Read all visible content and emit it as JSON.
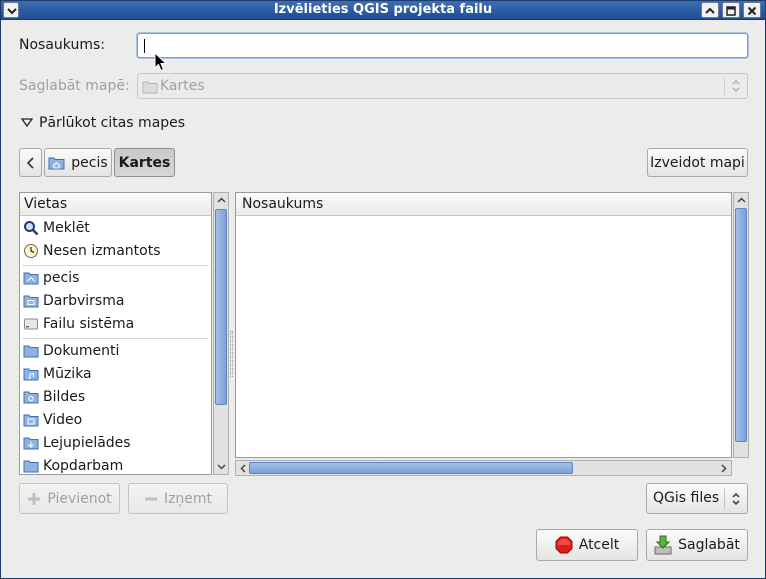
{
  "window": {
    "title": "Izvēlieties QGIS projekta failu"
  },
  "name_field": {
    "label": "Nosaukums:",
    "value": ""
  },
  "save_in": {
    "label": "Saglabāt mapē:",
    "value": "Kartes"
  },
  "browse_toggle": {
    "label": "Pārlūkot citas mapes"
  },
  "path_bar": {
    "items": [
      "pecis",
      "Kartes"
    ],
    "active": "Kartes"
  },
  "create_folder": {
    "label": "Izveidot mapi"
  },
  "places": {
    "header": "Vietas",
    "items": [
      {
        "label": "Meklēt",
        "icon": "search-icon"
      },
      {
        "label": "Nesen izmantots",
        "icon": "clock-icon"
      },
      {
        "label": "pecis",
        "icon": "home-folder-icon"
      },
      {
        "label": "Darbvirsma",
        "icon": "desktop-folder-icon"
      },
      {
        "label": "Failu sistēma",
        "icon": "drive-icon"
      },
      {
        "label": "Dokumenti",
        "icon": "folder-icon"
      },
      {
        "label": "Mūzika",
        "icon": "music-folder-icon"
      },
      {
        "label": "Bildes",
        "icon": "pictures-folder-icon"
      },
      {
        "label": "Video",
        "icon": "video-folder-icon"
      },
      {
        "label": "Lejupielādes",
        "icon": "download-folder-icon"
      },
      {
        "label": "Kopdarbam",
        "icon": "folder-icon"
      }
    ]
  },
  "files": {
    "header": "Nosaukums"
  },
  "add_button": {
    "label": "Pievienot"
  },
  "remove_button": {
    "label": "Izņemt"
  },
  "filter": {
    "value": "QGis files"
  },
  "cancel_button": {
    "label": "Atcelt"
  },
  "save_button": {
    "label": "Saglabāt"
  }
}
